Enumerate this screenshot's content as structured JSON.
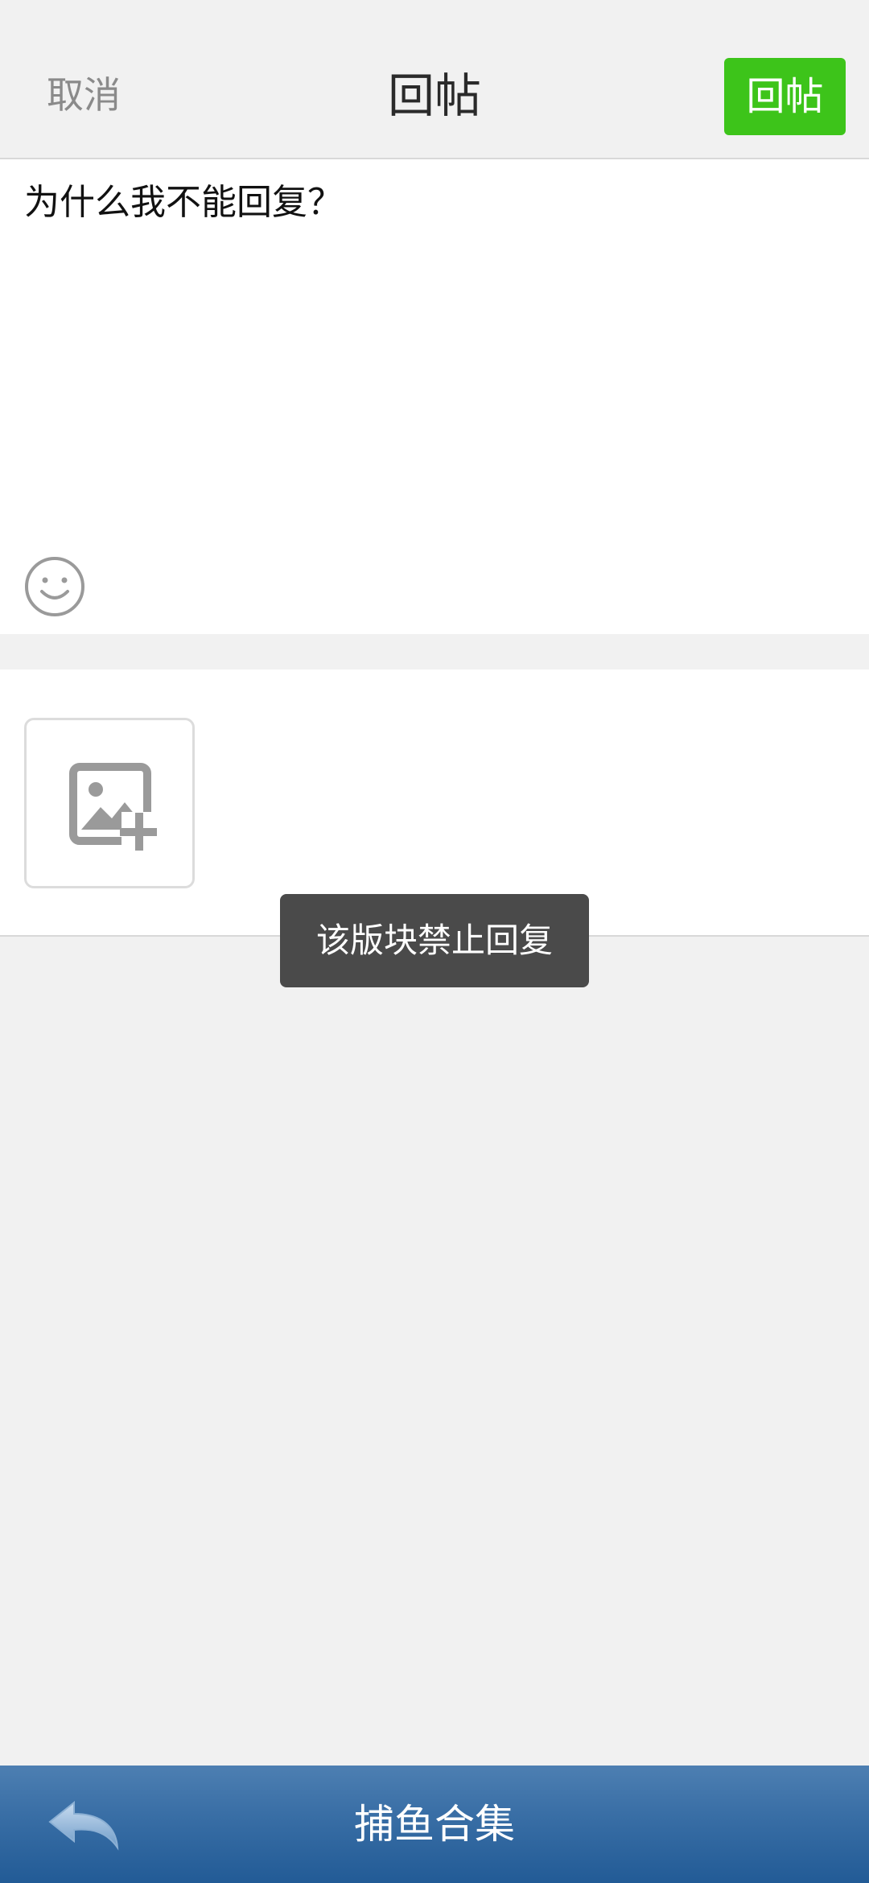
{
  "header": {
    "cancel_label": "取消",
    "title": "回帖",
    "reply_label": "回帖"
  },
  "compose": {
    "text": "为什么我不能回复？",
    "emoji_icon": "smiley-icon"
  },
  "attachments": {
    "add_image_icon": "add-image-icon"
  },
  "toast": {
    "message": "该版块禁止回复"
  },
  "bottom_bar": {
    "back_icon": "back-arrow-icon",
    "title": "捕鱼合集"
  },
  "colors": {
    "accent_green": "#3dc41a",
    "bar_blue": "#2a63a0",
    "toast_bg": "#4a4a4a"
  }
}
